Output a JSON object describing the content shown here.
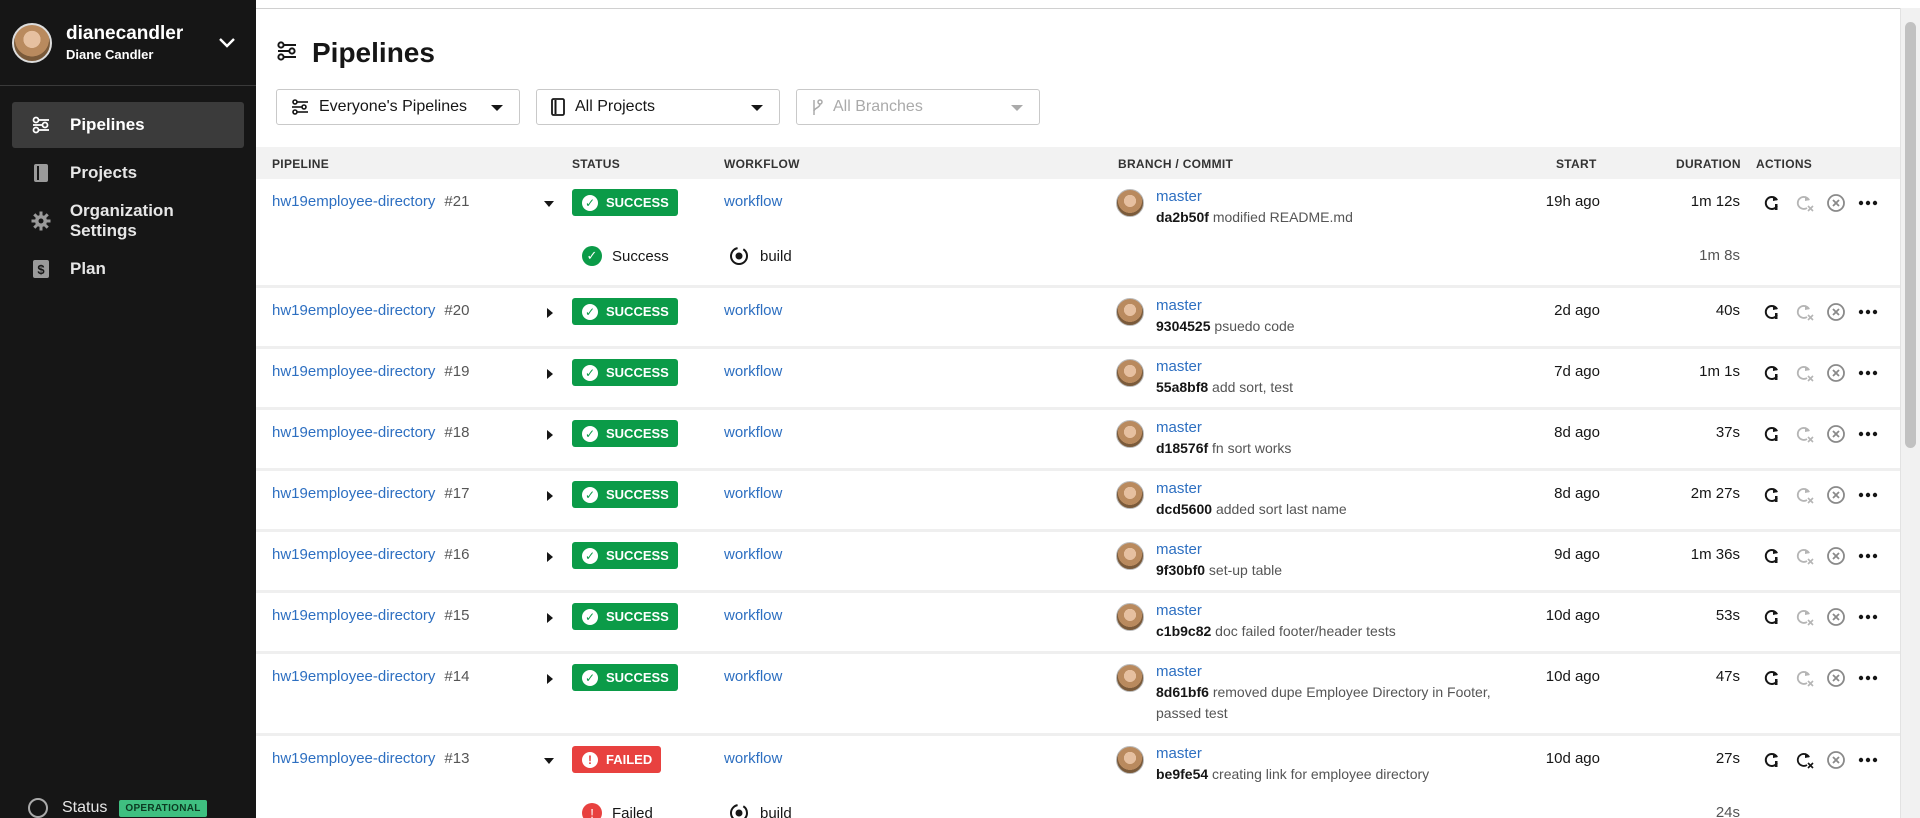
{
  "user": {
    "handle": "dianecandler",
    "full_name": "Diane Candler"
  },
  "nav": [
    {
      "label": "Pipelines",
      "icon": "pipelines-icon",
      "active": true
    },
    {
      "label": "Projects",
      "icon": "book-icon",
      "active": false
    },
    {
      "label": "Organization Settings",
      "icon": "gear-icon",
      "active": false
    },
    {
      "label": "Plan",
      "icon": "dollar-icon",
      "active": false
    }
  ],
  "status": {
    "label": "Status",
    "badge": "OPERATIONAL"
  },
  "page": {
    "title": "Pipelines"
  },
  "filters": {
    "pipelines": "Everyone's Pipelines",
    "projects": "All Projects",
    "branches": "All Branches"
  },
  "columns": {
    "pipeline": "PIPELINE",
    "status": "STATUS",
    "workflow": "WORKFLOW",
    "branch": "BRANCH / COMMIT",
    "start": "START",
    "duration": "DURATION",
    "actions": "ACTIONS"
  },
  "colors": {
    "success": "#0b9b48",
    "failed": "#e8413f",
    "link": "#2d6fc1",
    "sidebar": "#161616"
  },
  "rows": [
    {
      "project": "hw19employee-directory",
      "number": "#21",
      "status": "SUCCESS",
      "workflow": "workflow",
      "branch": "master",
      "sha": "da2b50f",
      "message": "modified README.md",
      "start": "19h ago",
      "duration": "1m 12s",
      "expanded": true,
      "job": {
        "status": "Success",
        "name": "build",
        "duration": "1m 8s"
      }
    },
    {
      "project": "hw19employee-directory",
      "number": "#20",
      "status": "SUCCESS",
      "workflow": "workflow",
      "branch": "master",
      "sha": "9304525",
      "message": "psuedo code",
      "start": "2d ago",
      "duration": "40s"
    },
    {
      "project": "hw19employee-directory",
      "number": "#19",
      "status": "SUCCESS",
      "workflow": "workflow",
      "branch": "master",
      "sha": "55a8bf8",
      "message": "add sort, test",
      "start": "7d ago",
      "duration": "1m 1s"
    },
    {
      "project": "hw19employee-directory",
      "number": "#18",
      "status": "SUCCESS",
      "workflow": "workflow",
      "branch": "master",
      "sha": "d18576f",
      "message": "fn sort works",
      "start": "8d ago",
      "duration": "37s"
    },
    {
      "project": "hw19employee-directory",
      "number": "#17",
      "status": "SUCCESS",
      "workflow": "workflow",
      "branch": "master",
      "sha": "dcd5600",
      "message": "added sort last name",
      "start": "8d ago",
      "duration": "2m 27s"
    },
    {
      "project": "hw19employee-directory",
      "number": "#16",
      "status": "SUCCESS",
      "workflow": "workflow",
      "branch": "master",
      "sha": "9f30bf0",
      "message": "set-up table",
      "start": "9d ago",
      "duration": "1m 36s"
    },
    {
      "project": "hw19employee-directory",
      "number": "#15",
      "status": "SUCCESS",
      "workflow": "workflow",
      "branch": "master",
      "sha": "c1b9c82",
      "message": "doc failed footer/header tests",
      "start": "10d ago",
      "duration": "53s"
    },
    {
      "project": "hw19employee-directory",
      "number": "#14",
      "status": "SUCCESS",
      "workflow": "workflow",
      "branch": "master",
      "sha": "8d61bf6",
      "message": "removed dupe Employee Directory in Footer,",
      "message2": "passed test",
      "start": "10d ago",
      "duration": "47s"
    },
    {
      "project": "hw19employee-directory",
      "number": "#13",
      "status": "FAILED",
      "workflow": "workflow",
      "branch": "master",
      "sha": "be9fe54",
      "message": "creating link for employee directory",
      "start": "10d ago",
      "duration": "27s",
      "expanded": true,
      "job": {
        "status": "Failed",
        "name": "build",
        "duration": "24s"
      }
    }
  ]
}
